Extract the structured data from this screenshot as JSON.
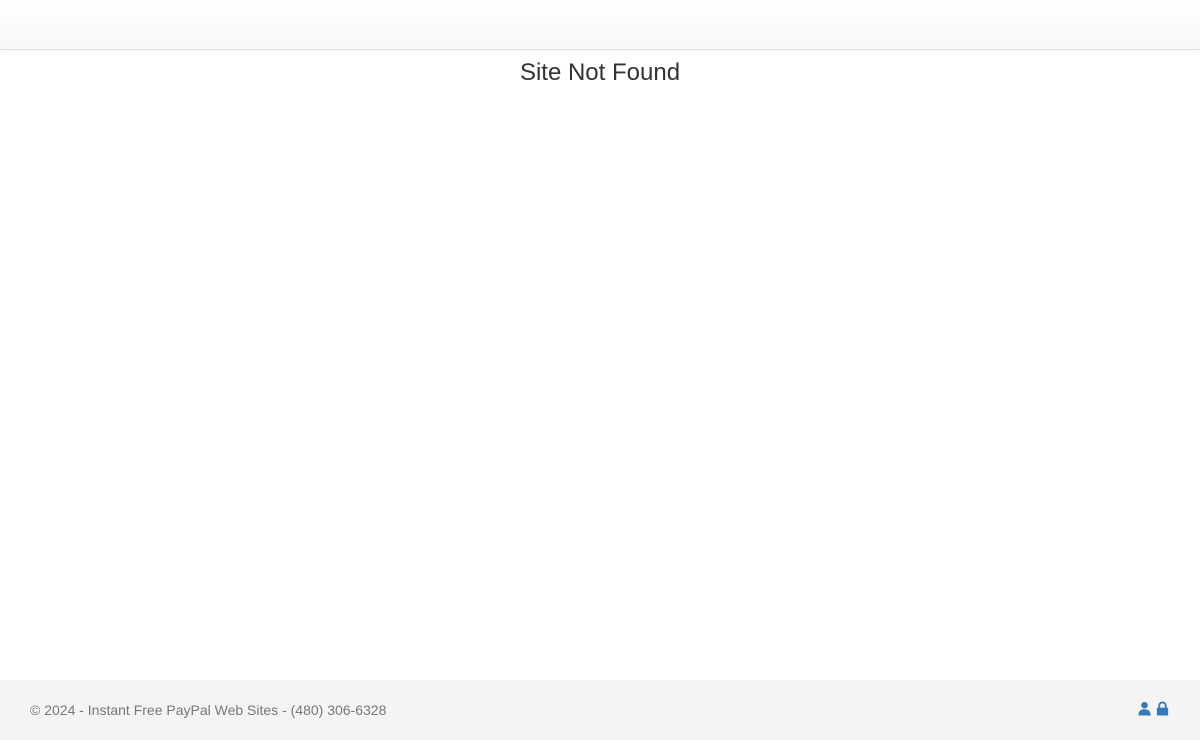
{
  "page": {
    "title": "Site Not Found"
  },
  "footer": {
    "copyright": "© 2024 - Instant Free PayPal Web Sites - (480) 306-6328",
    "icons": [
      {
        "name": "user-icon",
        "color": "#337ab7"
      },
      {
        "name": "lock-icon",
        "color": "#337ab7"
      }
    ]
  },
  "colors": {
    "link_blue": "#337ab7",
    "footer_bg": "#f4f4f4",
    "footer_text": "#777777",
    "title_text": "#333333"
  }
}
